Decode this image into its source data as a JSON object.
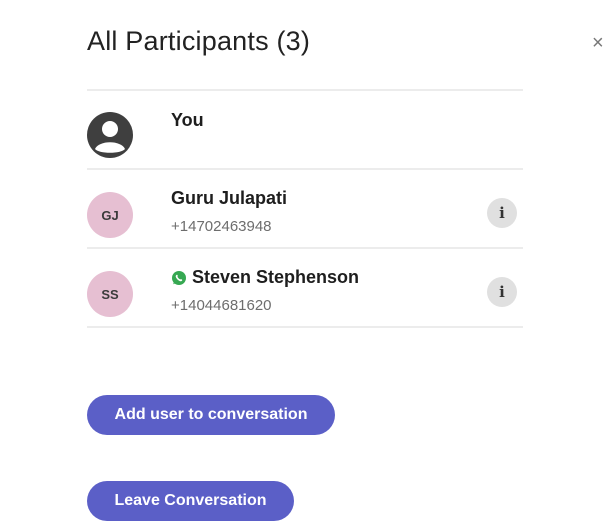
{
  "dialog": {
    "title": "All Participants (3)",
    "close_icon": "×"
  },
  "participants": [
    {
      "name": "You",
      "avatar": "person-icon"
    },
    {
      "initials": "GJ",
      "name": "Guru Julapati",
      "phone": "+14702463948",
      "info": "i"
    },
    {
      "initials": "SS",
      "name": "Steven Stephenson",
      "phone": "+14044681620",
      "info": "i",
      "channel_icon": "whatsapp-icon"
    }
  ],
  "actions": {
    "add_label": "Add user to conversation",
    "leave_label": "Leave Conversation"
  },
  "colors": {
    "accent": "#5b5fc7",
    "avatar_bg": "#e6bfd2",
    "whatsapp": "#36a852"
  }
}
